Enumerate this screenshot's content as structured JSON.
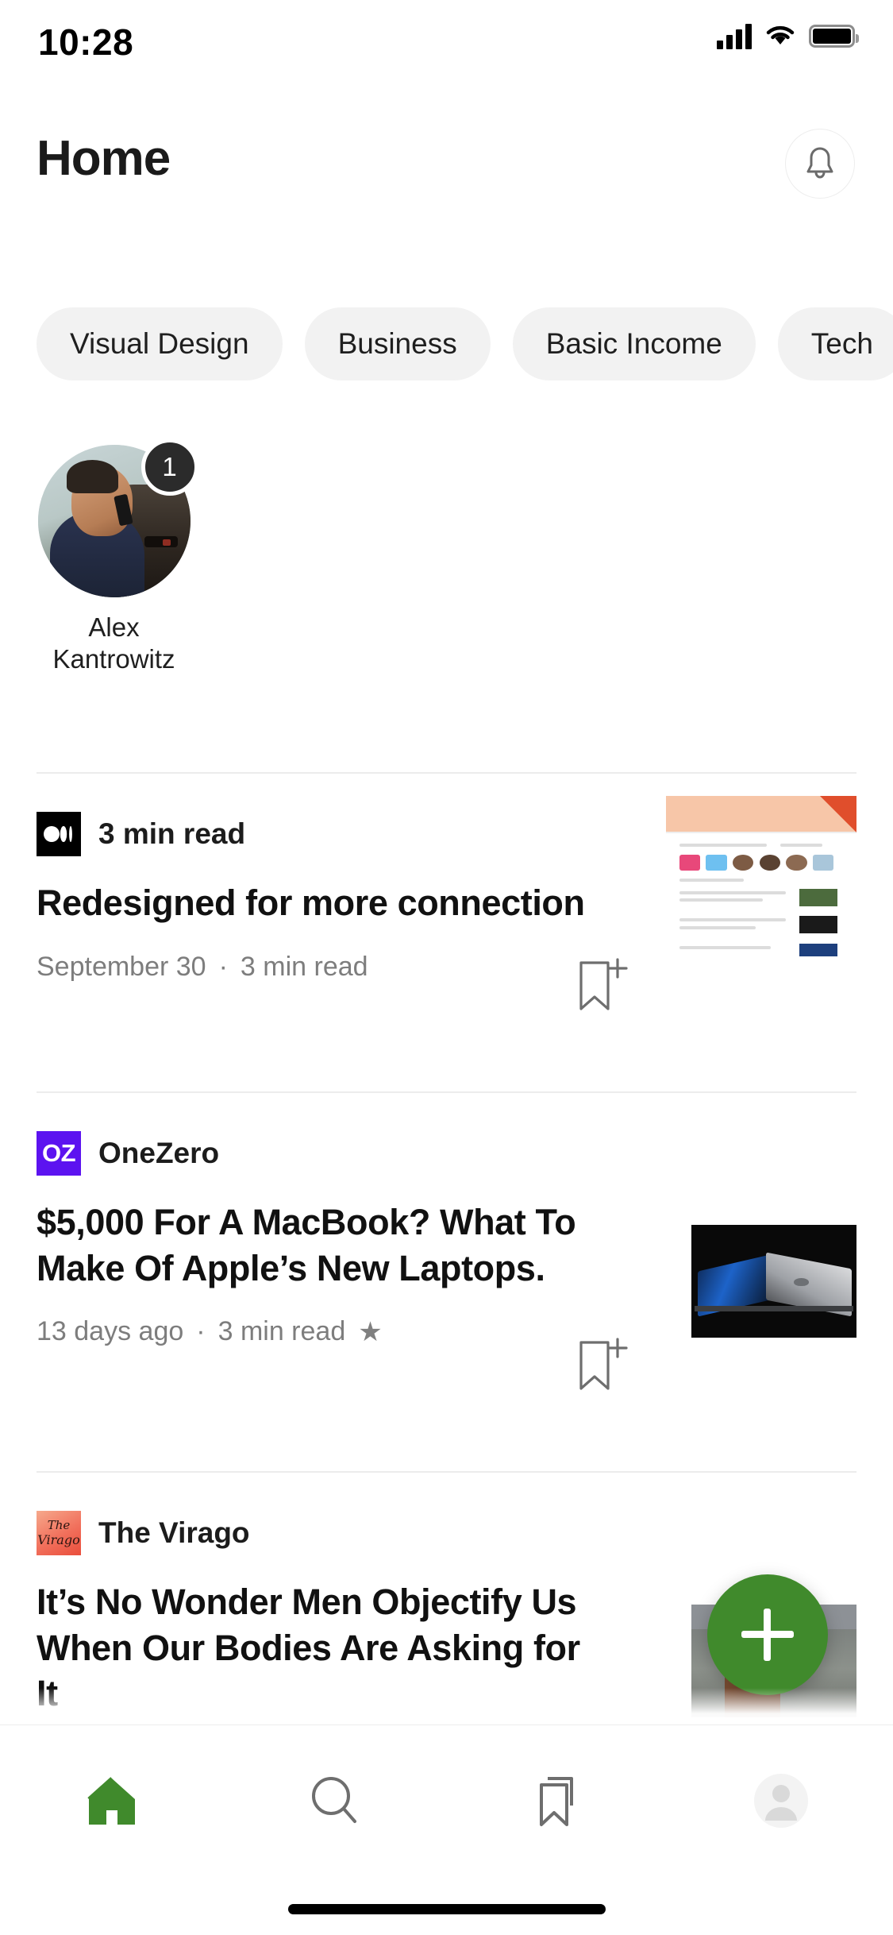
{
  "status_bar": {
    "time": "10:28",
    "signal_icon": "cellular-signal-icon",
    "wifi_icon": "wifi-icon",
    "battery_icon": "battery-icon"
  },
  "header": {
    "title": "Home",
    "notifications_icon": "bell-icon"
  },
  "topics": [
    {
      "label": "Visual Design"
    },
    {
      "label": "Business"
    },
    {
      "label": "Basic Income"
    },
    {
      "label": "Tech"
    }
  ],
  "stories": [
    {
      "name": "Alex\nKantrowitz",
      "name_line1": "Alex",
      "name_line2": "Kantrowitz",
      "badge": "1"
    }
  ],
  "feed": [
    {
      "publication": "",
      "publication_logo": "medium-logo-icon",
      "top_label": "3 min read",
      "title": "Redesigned for more connection",
      "meta_date": "September 30",
      "meta_sep": "·",
      "meta_read": "3 min read",
      "member_star": "",
      "bookmark_icon": "bookmark-add-icon",
      "thumbnail": "medium-feed-screenshot"
    },
    {
      "publication": "OneZero",
      "publication_logo": "onezero-logo-icon",
      "logo_text": "OZ",
      "title": "$5,000 For A MacBook? What To Make Of Apple’s New Laptops.",
      "meta_date": "13 days ago",
      "meta_sep": "·",
      "meta_read": "3 min read",
      "member_star": "★",
      "bookmark_icon": "bookmark-add-icon",
      "thumbnail": "macbook-pro-photo"
    },
    {
      "publication": "The Virago",
      "publication_logo": "the-virago-logo-icon",
      "logo_line1": "The",
      "logo_line2": "Virago",
      "title": "It’s No Wonder Men Objectify Us When Our Bodies Are Asking for It",
      "meta_date": "",
      "meta_sep": "",
      "meta_read": "",
      "member_star": "",
      "bookmark_icon": "",
      "thumbnail": "woman-by-the-sea-photo"
    }
  ],
  "fab": {
    "label": "+",
    "icon": "plus-icon",
    "color": "#408a2c"
  },
  "bottom_nav": [
    {
      "icon": "home-icon",
      "active": true
    },
    {
      "icon": "search-icon",
      "active": false
    },
    {
      "icon": "bookmarks-icon",
      "active": false
    },
    {
      "icon": "profile-avatar-icon",
      "active": false
    }
  ],
  "colors": {
    "accent_green": "#408a2c",
    "onezero_purple": "#5c13f0",
    "virago_orange": "#ea4e3c",
    "chip_bg": "#f2f2f2",
    "muted_text": "#7d7d7d"
  }
}
